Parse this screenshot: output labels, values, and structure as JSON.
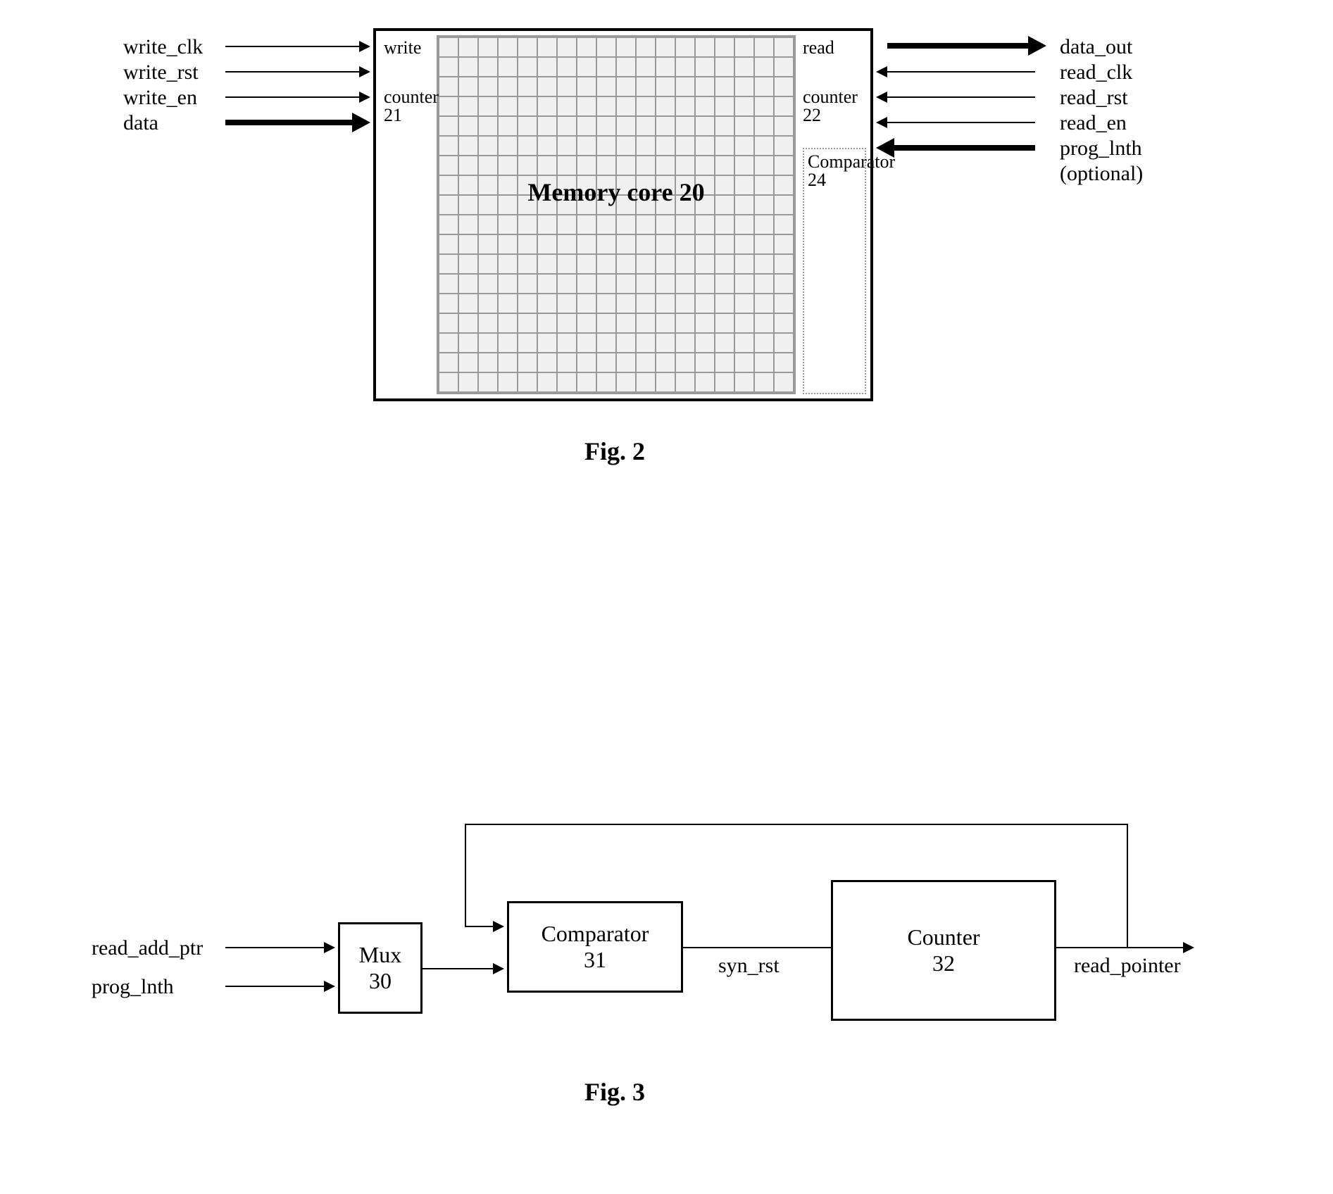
{
  "fig2": {
    "caption": "Fig. 2",
    "inputs": {
      "write_clk": "write_clk",
      "write_rst": "write_rst",
      "write_en": "write_en",
      "data": "data"
    },
    "outputs": {
      "data_out": "data_out",
      "read_clk": "read_clk",
      "read_rst": "read_rst",
      "read_en": "read_en",
      "prog_lnth": "prog_lnth",
      "prog_lnth_note": "(optional)"
    },
    "blocks": {
      "memory_core": "Memory core 20",
      "write_block": "write",
      "write_counter": "counter 21",
      "read_block": "read",
      "read_counter": "counter 22",
      "comparator": "Comparator 24"
    }
  },
  "fig3": {
    "caption": "Fig. 3",
    "inputs": {
      "read_add_ptr": "read_add_ptr",
      "prog_lnth": "prog_lnth"
    },
    "blocks": {
      "mux": "Mux",
      "mux_num": "30",
      "comparator": "Comparator",
      "comparator_num": "31",
      "counter": "Counter",
      "counter_num": "32"
    },
    "signals": {
      "syn_rst": "syn_rst",
      "read_pointer": "read_pointer"
    }
  }
}
